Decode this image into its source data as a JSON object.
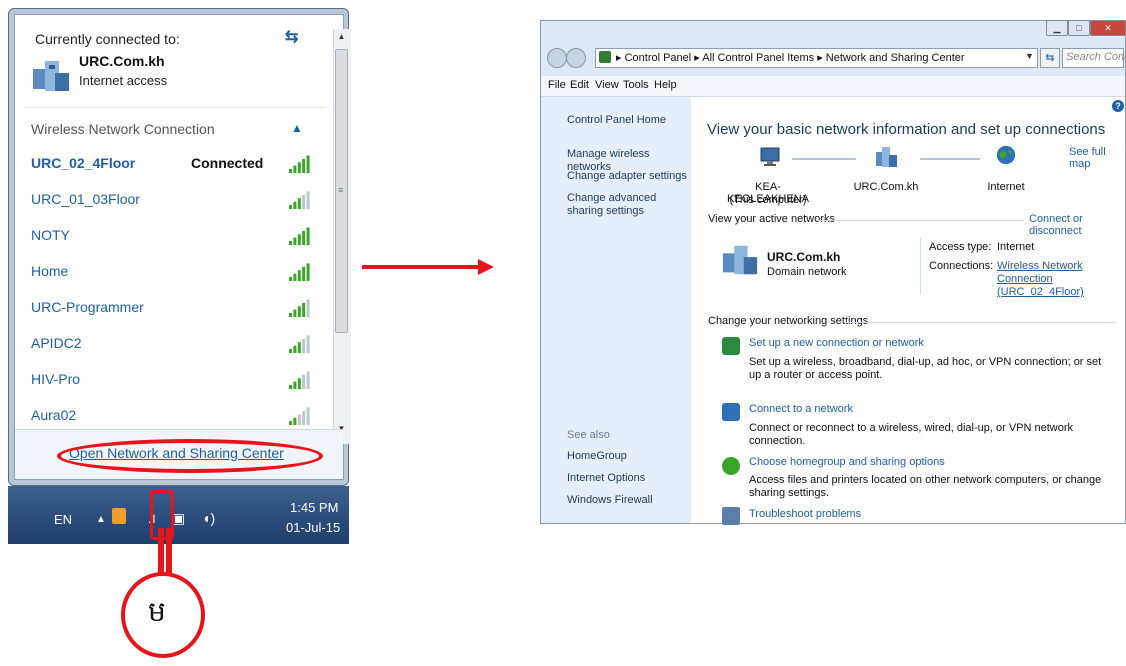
{
  "flyout": {
    "title": "Currently connected to:",
    "connected_network": {
      "name": "URC.Com.kh",
      "status": "Internet access"
    },
    "section_title": "Wireless Network Connection",
    "networks": [
      {
        "name": "URC_02_4Floor",
        "status": "Connected",
        "signal_bars": 5
      },
      {
        "name": "URC_01_03Floor",
        "status": "",
        "signal_bars": 3
      },
      {
        "name": "NOTY",
        "status": "",
        "signal_bars": 5
      },
      {
        "name": "Home",
        "status": "",
        "signal_bars": 5
      },
      {
        "name": "URC-Programmer",
        "status": "",
        "signal_bars": 4
      },
      {
        "name": "APIDC2",
        "status": "",
        "signal_bars": 3
      },
      {
        "name": "HIV-Pro",
        "status": "",
        "signal_bars": 3
      },
      {
        "name": "Aura02",
        "status": "",
        "signal_bars": 2
      }
    ],
    "footer_link": "Open Network and Sharing Center"
  },
  "taskbar": {
    "language": "EN",
    "time": "1:45 PM",
    "date": "01-Jul-15"
  },
  "callout": {
    "label": "ម"
  },
  "window": {
    "address_path": "▸ Control Panel ▸ All Control Panel Items ▸ Network and Sharing Center",
    "search_placeholder": "Search Cont...",
    "menu": [
      "File",
      "Edit",
      "View",
      "Tools",
      "Help"
    ],
    "sidebar": {
      "links": [
        "Control Panel Home",
        "Manage wireless networks",
        "Change adapter settings",
        "Change advanced sharing settings"
      ],
      "see_also_title": "See also",
      "see_also": [
        "HomeGroup",
        "Internet Options",
        "Windows Firewall"
      ]
    },
    "main": {
      "title": "View your basic network information and set up connections",
      "see_full_map": "See full map",
      "map": {
        "computer": {
          "name": "KEA-KEOLEAKHENA",
          "sub": "(This computer)"
        },
        "network": "URC.Com.kh",
        "internet": "Internet"
      },
      "active_networks_title": "View your active networks",
      "connect_or_disconnect": "Connect or disconnect",
      "active_network": {
        "name": "URC.Com.kh",
        "type": "Domain network",
        "access_type_label": "Access type:",
        "access_type_value": "Internet",
        "connections_label": "Connections:",
        "connections_value": "Wireless Network Connection (URC_02_4Floor)"
      },
      "change_settings_title": "Change your networking settings",
      "tasks": [
        {
          "link": "Set up a new connection or network",
          "desc": "Set up a wireless, broadband, dial-up, ad hoc, or VPN connection; or set up a router or access point."
        },
        {
          "link": "Connect to a network",
          "desc": "Connect or reconnect to a wireless, wired, dial-up, or VPN network connection."
        },
        {
          "link": "Choose homegroup and sharing options",
          "desc": "Access files and printers located on other network computers, or change sharing settings."
        },
        {
          "link": "Troubleshoot problems",
          "desc": ""
        }
      ]
    }
  },
  "colors": {
    "accent_red": "#e8141a",
    "link_blue": "#1f5fa8",
    "signal_green": "#3aa629"
  }
}
